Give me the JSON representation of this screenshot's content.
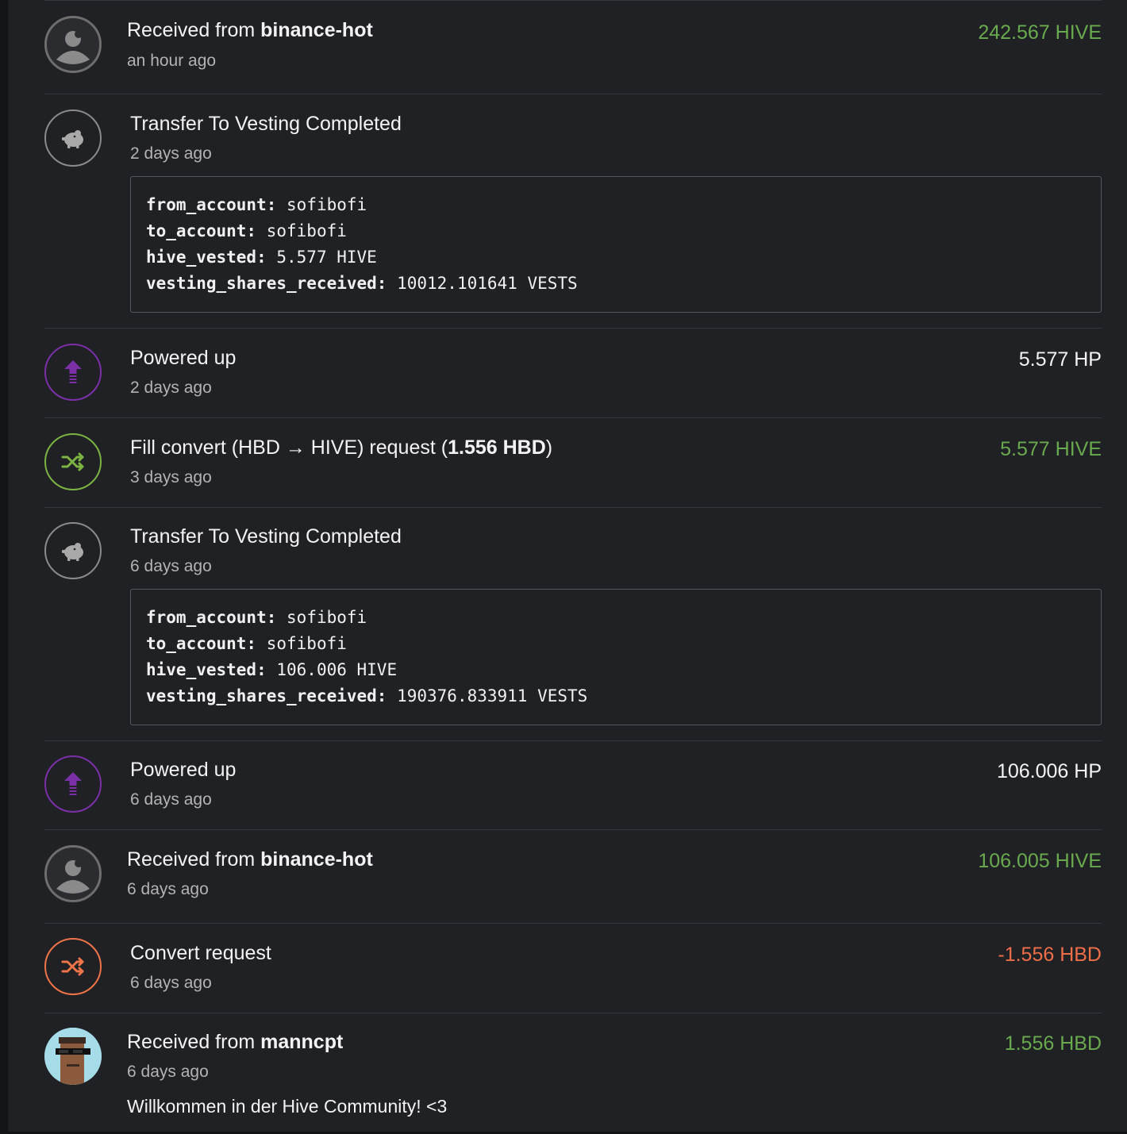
{
  "colors": {
    "positive": "#6aaa4e",
    "negative": "#ee6e48",
    "power_up": "#7b30a8",
    "neutral": "#f3f3f3"
  },
  "transactions": [
    {
      "type": "received",
      "icon": "user-avatar-icon",
      "title_prefix": "Received from ",
      "counterparty": "binance-hot",
      "time": "an hour ago",
      "amount": "242.567 HIVE"
    },
    {
      "type": "transfer_to_vesting",
      "icon": "piggy-bank-icon",
      "title": "Transfer To Vesting Completed",
      "time": "2 days ago",
      "details": [
        {
          "key": "from_account:",
          "value": "sofibofi"
        },
        {
          "key": "to_account:",
          "value": "sofibofi"
        },
        {
          "key": "hive_vested:",
          "value": "5.577 HIVE"
        },
        {
          "key": "vesting_shares_received:",
          "value": "10012.101641 VESTS"
        }
      ]
    },
    {
      "type": "power_up",
      "icon": "power-up-arrow-icon",
      "title": "Powered up",
      "time": "2 days ago",
      "amount": "5.577 HP"
    },
    {
      "type": "fill_convert",
      "icon": "shuffle-icon",
      "title_prefix": "Fill convert (HBD → HIVE) request (",
      "title_bold": "1.556 HBD",
      "title_suffix": ")",
      "time": "3 days ago",
      "amount": "5.577 HIVE"
    },
    {
      "type": "transfer_to_vesting",
      "icon": "piggy-bank-icon",
      "title": "Transfer To Vesting Completed",
      "time": "6 days ago",
      "details": [
        {
          "key": "from_account:",
          "value": "sofibofi"
        },
        {
          "key": "to_account:",
          "value": "sofibofi"
        },
        {
          "key": "hive_vested:",
          "value": "106.006 HIVE"
        },
        {
          "key": "vesting_shares_received:",
          "value": "190376.833911 VESTS"
        }
      ]
    },
    {
      "type": "power_up",
      "icon": "power-up-arrow-icon",
      "title": "Powered up",
      "time": "6 days ago",
      "amount": "106.006 HP"
    },
    {
      "type": "received",
      "icon": "user-avatar-icon",
      "title_prefix": "Received from ",
      "counterparty": "binance-hot",
      "time": "6 days ago",
      "amount": "106.005 HIVE"
    },
    {
      "type": "convert_request",
      "icon": "shuffle-icon",
      "title": "Convert request",
      "time": "6 days ago",
      "amount": "-1.556 HBD"
    },
    {
      "type": "received",
      "icon": "punk-avatar-icon",
      "title_prefix": "Received from ",
      "counterparty": "manncpt",
      "time": "6 days ago",
      "amount": "1.556 HBD",
      "memo": "Willkommen in der Hive Community! <3"
    }
  ]
}
